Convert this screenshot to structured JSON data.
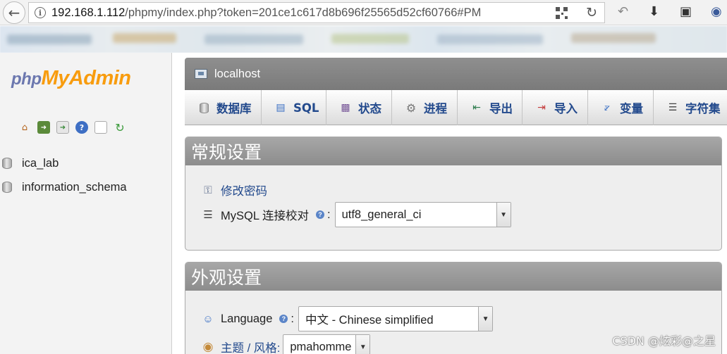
{
  "browser": {
    "url_host": "192.168.1.112",
    "url_rest": "/phpmy/index.php?token=201ce1c617d8b696f25565d52cf60766#PM"
  },
  "nav": {
    "logo_php": "php",
    "logo_my": "My",
    "logo_admin": "Admin",
    "databases": [
      "ica_lab",
      "information_schema"
    ]
  },
  "server": {
    "title": "localhost"
  },
  "tabs": [
    {
      "label": "数据库",
      "icon": "database-icon"
    },
    {
      "label": "SQL",
      "icon": "sql-icon"
    },
    {
      "label": "状态",
      "icon": "status-chart-icon"
    },
    {
      "label": "进程",
      "icon": "gear-icon"
    },
    {
      "label": "导出",
      "icon": "export-icon"
    },
    {
      "label": "导入",
      "icon": "import-icon"
    },
    {
      "label": "变量",
      "icon": "variables-icon"
    },
    {
      "label": "字符集",
      "icon": "charset-icon"
    }
  ],
  "general": {
    "title": "常规设置",
    "change_password": "修改密码",
    "collation_label": "MySQL 连接校对",
    "collation_value": "utf8_general_ci"
  },
  "appearance": {
    "title": "外观设置",
    "language_label": "Language",
    "language_value": "中文 - Chinese simplified",
    "theme_label": "主题 / 风格:",
    "theme_value": "pmahomme"
  },
  "watermark": "CSDN @炫彩@之星"
}
